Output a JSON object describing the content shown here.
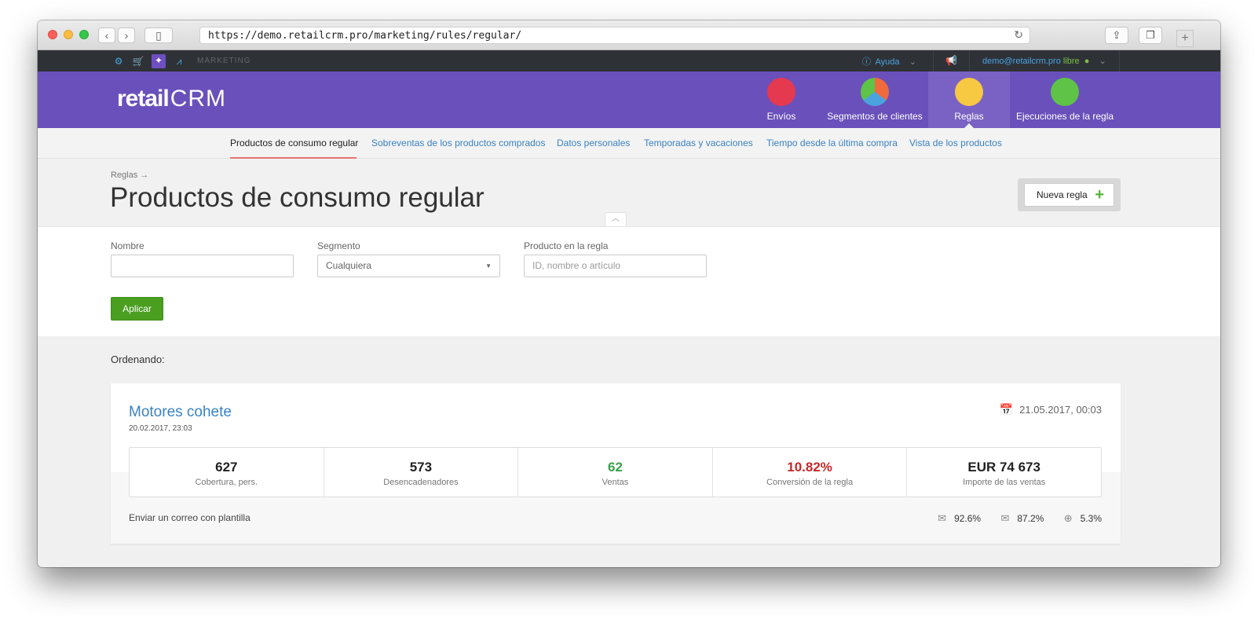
{
  "browser": {
    "url": "https://demo.retailcrm.pro/marketing/rules/regular/"
  },
  "topbar": {
    "section": "MARKETING",
    "help_label": "Ayuda",
    "user_email": "demo@retailcrm.pro",
    "user_status": "libre"
  },
  "header": {
    "logo_text": "retail",
    "logo_crm": "CRM",
    "nav": [
      {
        "label": "Envíos",
        "color": "#e53950"
      },
      {
        "label": "Segmentos de clientes",
        "color": "#f06a3c"
      },
      {
        "label": "Reglas",
        "color": "#f7c842"
      },
      {
        "label": "Ejecuciones de la regla",
        "color": "#5ec347"
      }
    ]
  },
  "subnav": [
    {
      "label": "Productos de consumo regular"
    },
    {
      "label": "Sobreventas de los productos comprados"
    },
    {
      "label": "Datos personales"
    },
    {
      "label": "Temporadas y vacaciones"
    },
    {
      "label": "Tiempo desde la última compra"
    },
    {
      "label": "Vista de los productos"
    }
  ],
  "page": {
    "breadcrumb": "Reglas →",
    "title": "Productos de consumo regular",
    "new_rule_label": "Nueva regla"
  },
  "filters": {
    "name_label": "Nombre",
    "name_value": "",
    "segment_label": "Segmento",
    "segment_value": "Cualquiera",
    "product_label": "Producto en la regla",
    "product_placeholder": "ID, nombre o artículo",
    "apply_label": "Aplicar"
  },
  "list": {
    "sort_label": "Ordenando:",
    "rules": [
      {
        "name": "Motores cohete",
        "created": "20.02.2017, 23:03",
        "date": "21.05.2017, 00:03",
        "stats": [
          {
            "value": "627",
            "label": "Cobertura, pers."
          },
          {
            "value": "573",
            "label": "Desencadenadores"
          },
          {
            "value": "62",
            "label": "Ventas"
          },
          {
            "value": "10.82%",
            "label": "Conversión de la regla"
          },
          {
            "value": "EUR 74 673",
            "label": "Importe de las ventas"
          }
        ],
        "action": "Enviar un correo con plantilla",
        "metrics": [
          {
            "icon": "envelope-icon",
            "value": "92.6%"
          },
          {
            "icon": "open-envelope-icon",
            "value": "87.2%"
          },
          {
            "icon": "globe-icon",
            "value": "5.3%"
          }
        ]
      }
    ]
  }
}
